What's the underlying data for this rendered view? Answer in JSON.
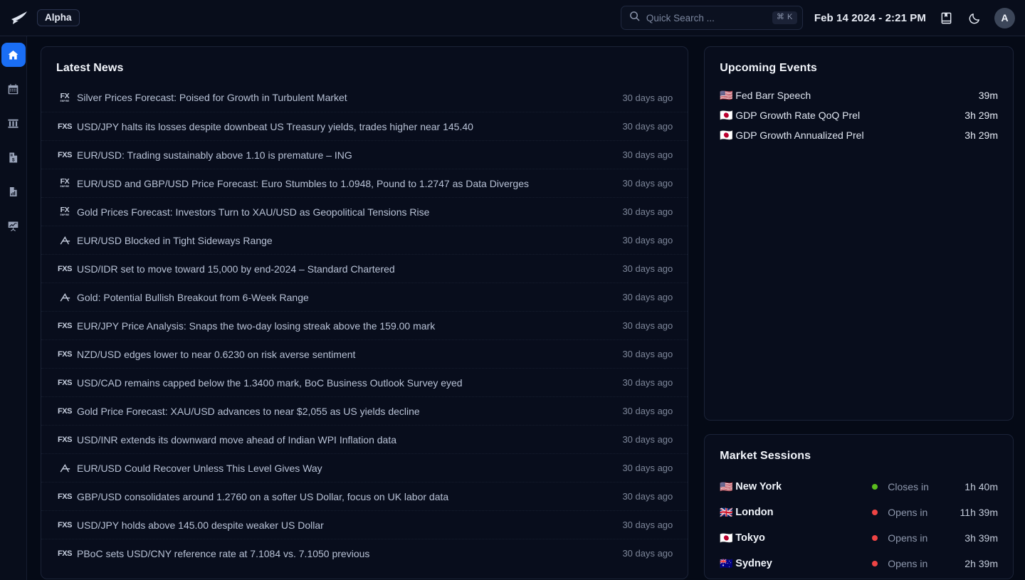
{
  "header": {
    "logo_icon": "bird-logo-icon",
    "badge": "Alpha",
    "search": {
      "placeholder": "Quick Search ...",
      "shortcut": "⌘ K",
      "icon": "search-icon"
    },
    "datetime": "Feb 14 2024 - 2:21 PM",
    "bookmark_icon": "bookmark-book-icon",
    "theme_icon": "moon-icon",
    "avatar_initial": "A"
  },
  "sidebar": {
    "items": [
      {
        "name": "home",
        "icon": "home-icon",
        "active": true
      },
      {
        "name": "calendar",
        "icon": "calendar-icon",
        "active": false
      },
      {
        "name": "markets",
        "icon": "bank-columns-icon",
        "active": false
      },
      {
        "name": "earnings",
        "icon": "document-dollar-icon",
        "active": false
      },
      {
        "name": "reports",
        "icon": "bar-chart-document-icon",
        "active": false
      },
      {
        "name": "analysis",
        "icon": "presentation-chart-icon",
        "active": false
      }
    ]
  },
  "news": {
    "title": "Latest News",
    "items": [
      {
        "source": "FXE",
        "title": "Silver Prices Forecast: Poised for Growth in Turbulent Market",
        "time": "30 days ago"
      },
      {
        "source": "FXS",
        "title": "USD/JPY halts its losses despite downbeat US Treasury yields, trades higher near 145.40",
        "time": "30 days ago"
      },
      {
        "source": "FXS",
        "title": "EUR/USD: Trading sustainably above 1.10 is premature – ING",
        "time": "30 days ago"
      },
      {
        "source": "FXE",
        "title": "EUR/USD and GBP/USD Price Forecast: Euro Stumbles to 1.0948, Pound to 1.2747 as Data Diverges",
        "time": "30 days ago"
      },
      {
        "source": "FXE",
        "title": "Gold Prices Forecast: Investors Turn to XAU/USD as Geopolitical Tensions Rise",
        "time": "30 days ago"
      },
      {
        "source": "A",
        "title": "EUR/USD Blocked in Tight Sideways Range",
        "time": "30 days ago"
      },
      {
        "source": "FXS",
        "title": "USD/IDR set to move toward 15,000 by end-2024 – Standard Chartered",
        "time": "30 days ago"
      },
      {
        "source": "A",
        "title": "Gold: Potential Bullish Breakout from 6-Week Range",
        "time": "30 days ago"
      },
      {
        "source": "FXS",
        "title": "EUR/JPY Price Analysis: Snaps the two-day losing streak above the 159.00 mark",
        "time": "30 days ago"
      },
      {
        "source": "FXS",
        "title": "NZD/USD edges lower to near 0.6230 on risk averse sentiment",
        "time": "30 days ago"
      },
      {
        "source": "FXS",
        "title": "USD/CAD remains capped below the 1.3400 mark, BoC Business Outlook Survey eyed",
        "time": "30 days ago"
      },
      {
        "source": "FXS",
        "title": "Gold Price Forecast: XAU/USD advances to near $2,055 as US yields decline",
        "time": "30 days ago"
      },
      {
        "source": "FXS",
        "title": "USD/INR extends its downward move ahead of Indian WPI Inflation data",
        "time": "30 days ago"
      },
      {
        "source": "A",
        "title": "EUR/USD Could Recover Unless This Level Gives Way",
        "time": "30 days ago"
      },
      {
        "source": "FXS",
        "title": "GBP/USD consolidates around 1.2760 on a softer US Dollar, focus on UK labor data",
        "time": "30 days ago"
      },
      {
        "source": "FXS",
        "title": "USD/JPY holds above 145.00 despite weaker US Dollar",
        "time": "30 days ago"
      },
      {
        "source": "FXS",
        "title": "PBoC sets USD/CNY reference rate at 7.1084 vs. 7.1050 previous",
        "time": "30 days ago"
      }
    ]
  },
  "events": {
    "title": "Upcoming Events",
    "items": [
      {
        "flag": "🇺🇸",
        "name": "Fed Barr Speech",
        "time": "39m"
      },
      {
        "flag": "🇯🇵",
        "name": "GDP Growth Rate QoQ Prel",
        "time": "3h 29m"
      },
      {
        "flag": "🇯🇵",
        "name": "GDP Growth Annualized Prel",
        "time": "3h 29m"
      }
    ]
  },
  "sessions": {
    "title": "Market Sessions",
    "items": [
      {
        "flag": "🇺🇸",
        "city": "New York",
        "status_color": "#5bbd1e",
        "state": "Closes in",
        "remaining": "1h 40m"
      },
      {
        "flag": "🇬🇧",
        "city": "London",
        "status_color": "#ef4444",
        "state": "Opens in",
        "remaining": "11h 39m"
      },
      {
        "flag": "🇯🇵",
        "city": "Tokyo",
        "status_color": "#ef4444",
        "state": "Opens in",
        "remaining": "3h 39m"
      },
      {
        "flag": "🇦🇺",
        "city": "Sydney",
        "status_color": "#ef4444",
        "state": "Opens in",
        "remaining": "2h 39m"
      }
    ]
  },
  "colors": {
    "accent": "#1a6ef5",
    "page_bg": "#050a16",
    "card_bg": "#080d1c",
    "open_green": "#5bbd1e",
    "closed_red": "#ef4444"
  }
}
